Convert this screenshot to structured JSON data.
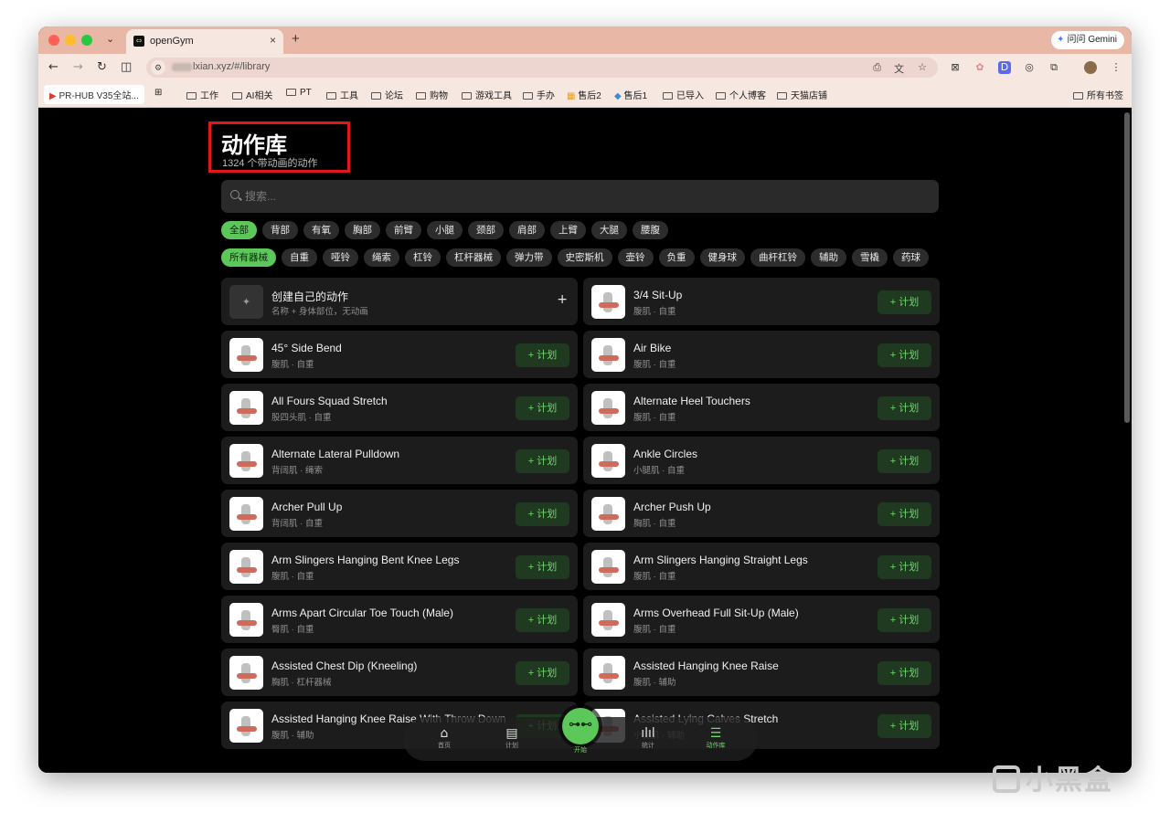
{
  "browser": {
    "tab_title": "openGym",
    "tab_favicon": "⇔",
    "tab_close": "×",
    "new_tab": "+",
    "dropdown": "⌄",
    "gemini_label": "问问 Gemini",
    "url": "lxian.xyz/#/library",
    "bookmarks": [
      {
        "label": "PR-HUB V35全站..."
      },
      {
        "label": "工作"
      },
      {
        "label": "AI相关"
      },
      {
        "label": "PT"
      },
      {
        "label": "工具"
      },
      {
        "label": "论坛"
      },
      {
        "label": "购物"
      },
      {
        "label": "游戏工具"
      },
      {
        "label": "手办"
      },
      {
        "label": "售后2"
      },
      {
        "label": "售后1"
      },
      {
        "label": "已导入"
      },
      {
        "label": "个人博客"
      },
      {
        "label": "天猫店铺"
      }
    ],
    "all_bookmarks": "所有书签"
  },
  "header": {
    "title": "动作库",
    "subtitle": "1324 个带动画的动作"
  },
  "search": {
    "placeholder": "搜索..."
  },
  "body_filters": [
    "全部",
    "背部",
    "有氧",
    "胸部",
    "前臂",
    "小腿",
    "颈部",
    "肩部",
    "上臂",
    "大腿",
    "腰腹"
  ],
  "equipment_filters": [
    "所有器械",
    "自重",
    "哑铃",
    "绳索",
    "杠铃",
    "杠杆器械",
    "弹力带",
    "史密斯机",
    "壶铃",
    "负重",
    "健身球",
    "曲杆杠铃",
    "辅助",
    "雪橇",
    "药球"
  ],
  "create_card": {
    "title": "创建自己的动作",
    "subtitle": "名称 + 身体部位，无动画",
    "plus": "+"
  },
  "plan_label": "+ 计划",
  "exercises": [
    {
      "name": "3/4 Sit-Up",
      "meta": "腹肌 · 自重"
    },
    {
      "name": "45° Side Bend",
      "meta": "腹肌 · 自重"
    },
    {
      "name": "Air Bike",
      "meta": "腹肌 · 自重"
    },
    {
      "name": "All Fours Squad Stretch",
      "meta": "股四头肌 · 自重"
    },
    {
      "name": "Alternate Heel Touchers",
      "meta": "腹肌 · 自重"
    },
    {
      "name": "Alternate Lateral Pulldown",
      "meta": "背阔肌 · 绳索"
    },
    {
      "name": "Ankle Circles",
      "meta": "小腿肌 · 自重"
    },
    {
      "name": "Archer Pull Up",
      "meta": "背阔肌 · 自重"
    },
    {
      "name": "Archer Push Up",
      "meta": "胸肌 · 自重"
    },
    {
      "name": "Arm Slingers Hanging Bent Knee Legs",
      "meta": "腹肌 · 自重"
    },
    {
      "name": "Arm Slingers Hanging Straight Legs",
      "meta": "腹肌 · 自重"
    },
    {
      "name": "Arms Apart Circular Toe Touch (Male)",
      "meta": "臀肌 · 自重"
    },
    {
      "name": "Arms Overhead Full Sit-Up (Male)",
      "meta": "腹肌 · 自重"
    },
    {
      "name": "Assisted Chest Dip (Kneeling)",
      "meta": "胸肌 · 杠杆器械"
    },
    {
      "name": "Assisted Hanging Knee Raise",
      "meta": "腹肌 · 辅助"
    },
    {
      "name": "Assisted Hanging Knee Raise With Throw Down",
      "meta": "腹肌 · 辅助"
    },
    {
      "name": "Assisted Lying Calves Stretch",
      "meta": "小腿肌 · 辅助"
    }
  ],
  "bottom_nav": {
    "home": "首页",
    "plan": "计划",
    "start": "开始",
    "stats": "统计",
    "library": "动作库"
  },
  "watermark": "小黑盒",
  "colors": {
    "accent": "#5cc85a",
    "background": "#000000",
    "card": "#1c1c1c",
    "highlight": "#e01818"
  }
}
